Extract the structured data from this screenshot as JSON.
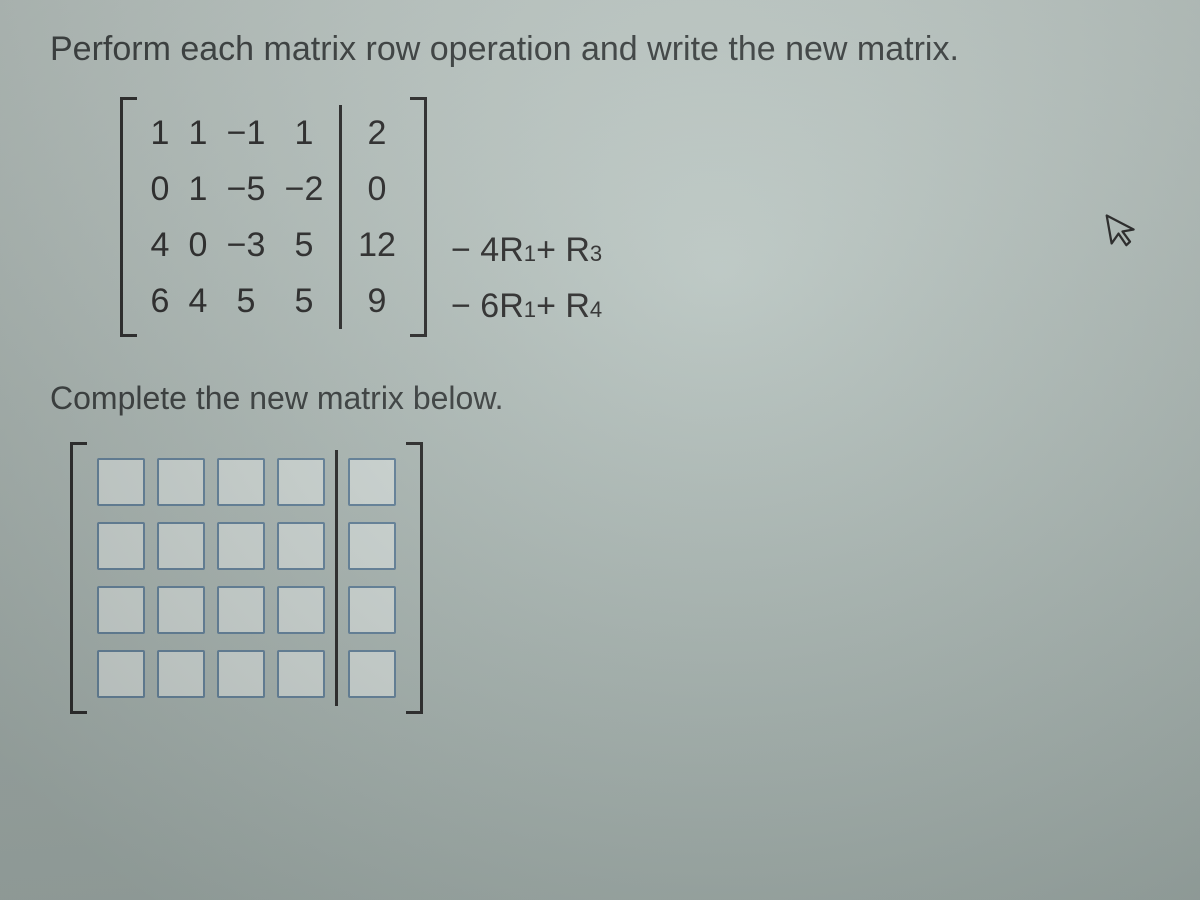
{
  "instruction": "Perform each matrix row operation and write the new matrix.",
  "matrix": {
    "rows": [
      {
        "c1": "1",
        "c2": "1",
        "c3": "−1",
        "c4": "1",
        "aug": "2"
      },
      {
        "c1": "0",
        "c2": "1",
        "c3": "−5",
        "c4": "−2",
        "aug": "0"
      },
      {
        "c1": "4",
        "c2": "0",
        "c3": "−3",
        "c4": "5",
        "aug": "12"
      },
      {
        "c1": "6",
        "c2": "4",
        "c3": "5",
        "c4": "5",
        "aug": "9"
      }
    ]
  },
  "operations": {
    "op1_prefix": "− 4R",
    "op1_sub1": "1",
    "op1_mid": " + R",
    "op1_sub2": "3",
    "op2_prefix": "− 6R",
    "op2_sub1": "1",
    "op2_mid": " + R",
    "op2_sub2": "4"
  },
  "prompt2": "Complete the new matrix below.",
  "cursor_glyph": "↖"
}
